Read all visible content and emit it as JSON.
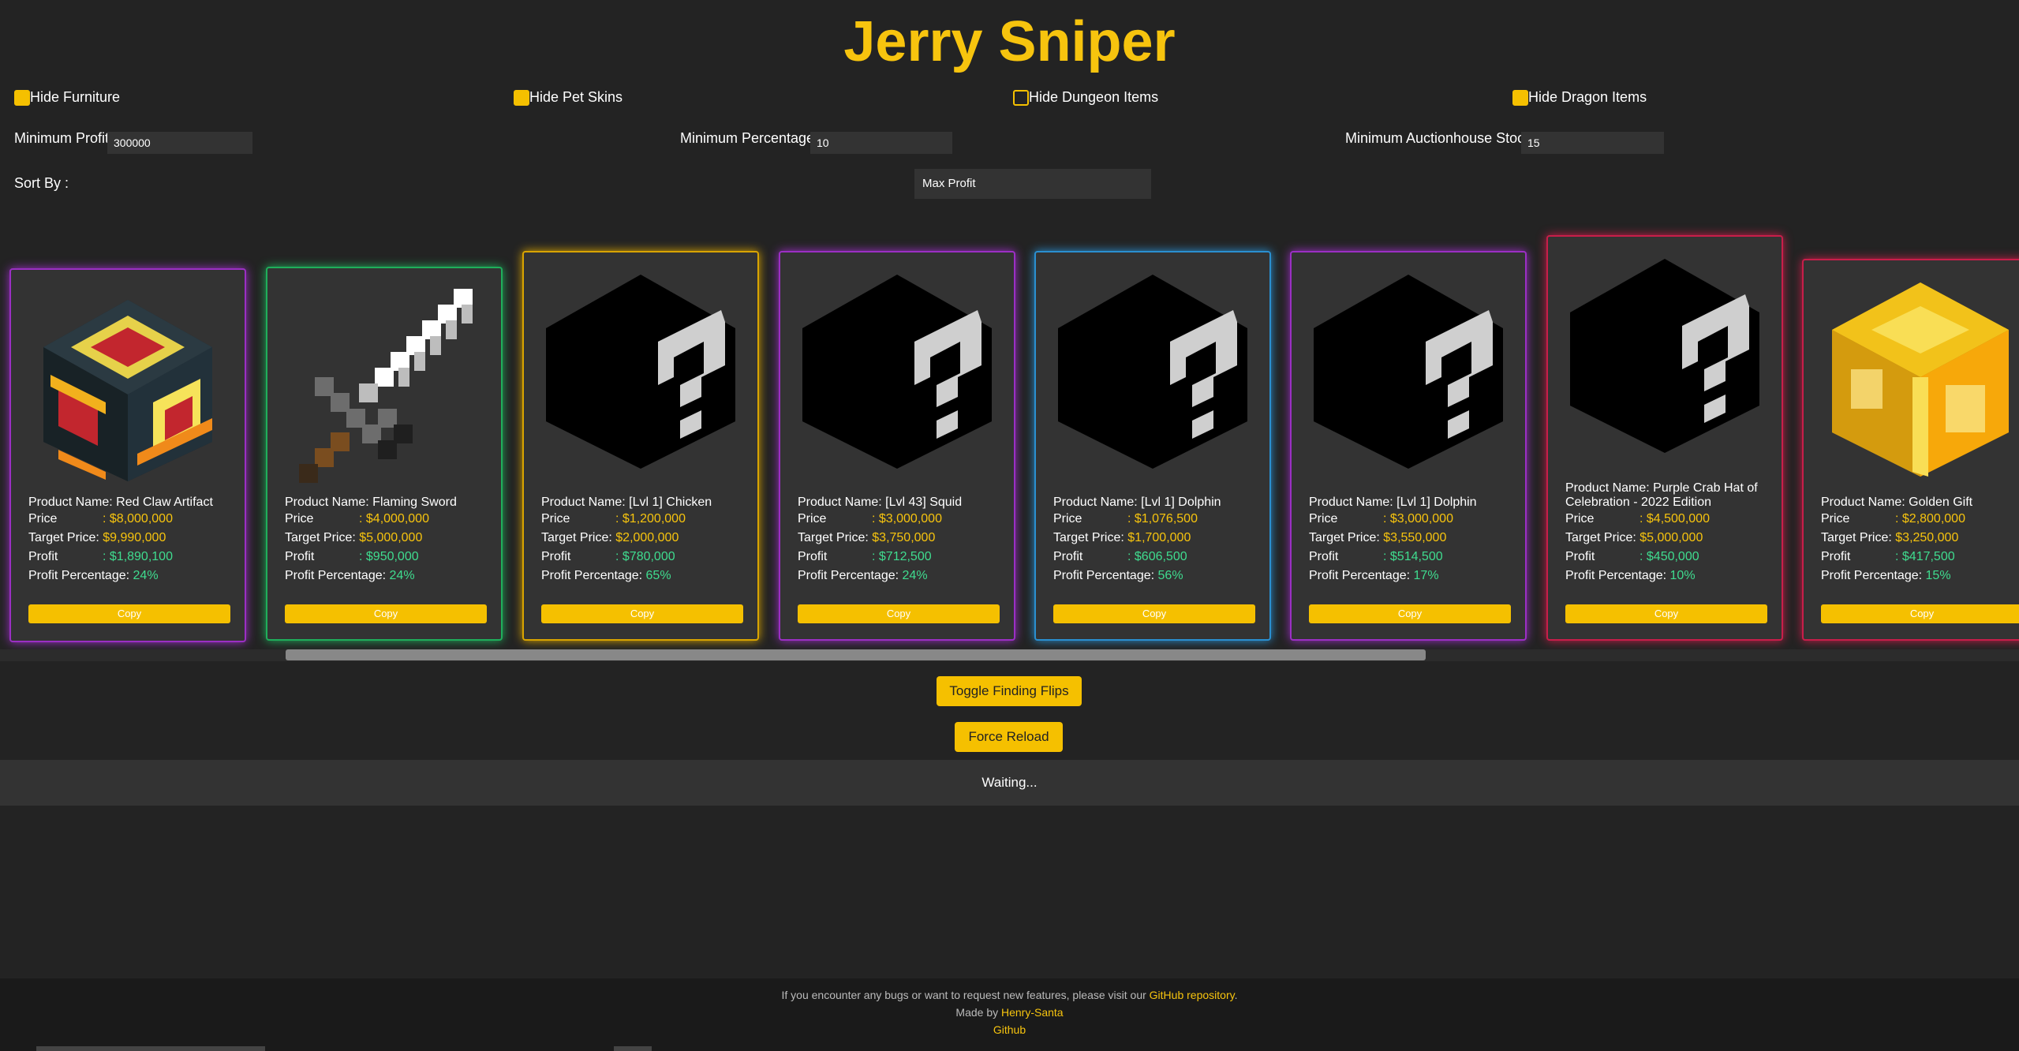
{
  "app": {
    "title": "Jerry Sniper"
  },
  "filters": [
    {
      "label": "Hide Furniture",
      "checked": true
    },
    {
      "label": "Hide Pet Skins",
      "checked": true
    },
    {
      "label": "Hide Dungeon Items",
      "checked": false
    },
    {
      "label": "Hide Dragon Items",
      "checked": true
    }
  ],
  "fields": {
    "min_profit": {
      "label": "Minimum Profit:",
      "value": "300000"
    },
    "min_percentage": {
      "label": "Minimum Percentage:",
      "value": "10"
    },
    "min_stock": {
      "label": "Minimum Auctionhouse Stock:",
      "value": "15"
    },
    "sort_by": {
      "label": "Sort By :",
      "value": "Max Profit"
    }
  },
  "card_labels": {
    "name": "Product Name:",
    "price": "Price",
    "target": "Target Price:",
    "profit": "Profit",
    "percentage": "Profit Percentage:",
    "copy": "Copy"
  },
  "cards": [
    {
      "name": "Red Claw Artifact",
      "price": ": $8,000,000",
      "target": "$9,990,000",
      "profit": ": $1,890,100",
      "percentage": "24%",
      "rarity_color": "#9b2fc4",
      "icon": "artifact-icon"
    },
    {
      "name": "Flaming Sword",
      "price": ": $4,000,000",
      "target": "$5,000,000",
      "profit": ": $950,000",
      "percentage": "24%",
      "rarity_color": "#1fae5b",
      "icon": "sword-icon"
    },
    {
      "name": "[Lvl 1] Chicken",
      "price": ": $1,200,000",
      "target": "$2,000,000",
      "profit": ": $780,000",
      "percentage": "65%",
      "rarity_color": "#d9a400",
      "icon": "unknown-item-icon"
    },
    {
      "name": "[Lvl 43] Squid",
      "price": ": $3,000,000",
      "target": "$3,750,000",
      "profit": ": $712,500",
      "percentage": "24%",
      "rarity_color": "#9b2fc4",
      "icon": "unknown-item-icon"
    },
    {
      "name": "[Lvl 1] Dolphin",
      "price": ": $1,076,500",
      "target": "$1,700,000",
      "profit": ": $606,500",
      "percentage": "56%",
      "rarity_color": "#2a8fd0",
      "icon": "unknown-item-icon"
    },
    {
      "name": "[Lvl 1] Dolphin",
      "price": ": $3,000,000",
      "target": "$3,550,000",
      "profit": ": $514,500",
      "percentage": "17%",
      "rarity_color": "#9b2fc4",
      "icon": "unknown-item-icon"
    },
    {
      "name": "Purple Crab Hat of Celebration - 2022 Edition",
      "price": ": $4,500,000",
      "target": "$5,000,000",
      "profit": ": $450,000",
      "percentage": "10%",
      "rarity_color": "#c81e4a",
      "icon": "unknown-item-icon"
    },
    {
      "name": "Golden Gift",
      "price": ": $2,800,000",
      "target": "$3,250,000",
      "profit": ": $417,500",
      "percentage": "15%",
      "rarity_color": "#c81e4a",
      "icon": "golden-gift-icon"
    }
  ],
  "buttons": {
    "toggle": "Toggle Finding Flips",
    "reload": "Force Reload"
  },
  "status": "Waiting...",
  "footer": {
    "line1_prefix": "If you encounter any bugs or want to request new features, please visit our ",
    "line1_link": "GitHub repository",
    "line1_suffix": ".",
    "line2_prefix": "Made by ",
    "line2_link": "Henry-Santa",
    "line3_link": "Github"
  }
}
